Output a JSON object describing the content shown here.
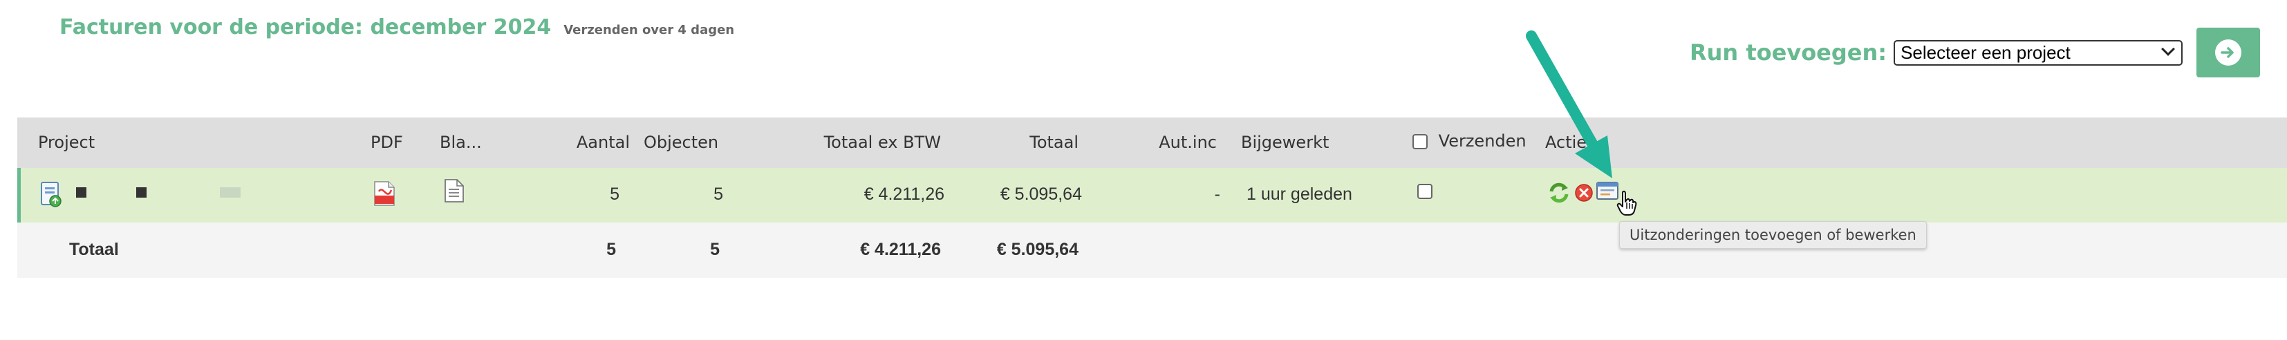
{
  "header": {
    "title": "Facturen voor de periode: december 2024",
    "subtitle": "Verzenden over 4 dagen"
  },
  "run": {
    "label": "Run toevoegen:",
    "select_value": "Selecteer een project"
  },
  "table": {
    "columns": {
      "project": "Project",
      "pdf": "PDF",
      "bla": "Bla...",
      "aantal": "Aantal",
      "objecten": "Objecten",
      "totaal_ex": "Totaal ex BTW",
      "totaal": "Totaal",
      "autinc": "Aut.inc",
      "bijgewerkt": "Bijgewerkt",
      "verzenden": "Verzenden",
      "acties": "Acties"
    },
    "row": {
      "aantal": "5",
      "objecten": "5",
      "totaal_ex": "€ 4.211,26",
      "totaal": "€ 5.095,64",
      "autinc": "-",
      "bijgewerkt": "1 uur geleden"
    },
    "totals": {
      "label": "Totaal",
      "aantal": "5",
      "objecten": "5",
      "totaal_ex": "€ 4.211,26",
      "totaal": "€ 5.095,64"
    }
  },
  "tooltip": "Uitzonderingen toevoegen of bewerken",
  "colors": {
    "accent": "#67b990",
    "row_bg": "#dfefcd",
    "header_bg": "#dedede",
    "arrow": "#1fb39a"
  }
}
